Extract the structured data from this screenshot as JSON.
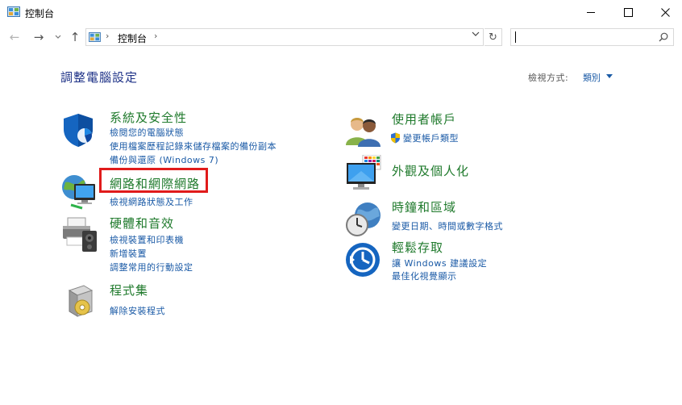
{
  "window": {
    "title": "控制台",
    "minimize": "—",
    "maximize": "☐",
    "close": "✕"
  },
  "nav": {
    "back_icon": "←",
    "forward_icon": "→",
    "recent_icon": "⌄",
    "up_icon": "↑",
    "address_text": "控制台",
    "address_separator": "›",
    "dropdown_icon": "⌄",
    "refresh_icon": "↻",
    "search_placeholder": ""
  },
  "header": {
    "title": "調整電腦設定",
    "view_by_label": "檢視方式:",
    "view_by_value": "類別"
  },
  "categories_left": [
    {
      "title": "系統及安全性",
      "links": [
        "檢閱您的電腦狀態",
        "使用檔案歷程記錄來儲存檔案的備份副本",
        "備份與還原 (Windows 7)"
      ]
    },
    {
      "title": "網路和網際網路",
      "links": [
        "檢視網路狀態及工作"
      ]
    },
    {
      "title": "硬體和音效",
      "links": [
        "檢視裝置和印表機",
        "新增裝置",
        "調整常用的行動設定"
      ]
    },
    {
      "title": "程式集",
      "links": [
        "解除安裝程式"
      ]
    }
  ],
  "categories_right": [
    {
      "title": "使用者帳戶",
      "links": [
        "變更帳戶類型"
      ]
    },
    {
      "title": "外觀及個人化",
      "links": []
    },
    {
      "title": "時鐘和區域",
      "links": [
        "變更日期、時間或數字格式"
      ]
    },
    {
      "title": "輕鬆存取",
      "links": [
        "讓 Windows 建議設定",
        "最佳化視覺顯示"
      ]
    }
  ],
  "colors": {
    "category_title": "#1f7a2c",
    "link": "#1a5aa6",
    "page_title": "#1e3287",
    "highlight_box": "#e01b1b"
  }
}
